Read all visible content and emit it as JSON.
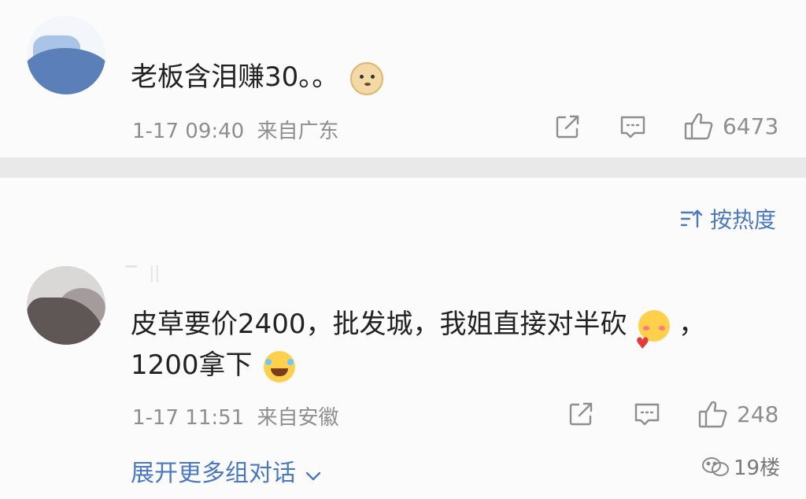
{
  "comments": [
    {
      "text": "老板含泪赚30。。",
      "emoji_end": "doge-emoji",
      "time": "1-17 09:40",
      "location": "来自广东",
      "likes": "6473"
    },
    {
      "line1": "皮草要价2400，批发城，我姐直接对半砍",
      "line1_tail": "，",
      "line2": "1200拿下",
      "emoji_mid": "shy-emoji",
      "emoji_end": "laugh-cry-emoji",
      "time": "1-17 11:51",
      "location": "来自安徽",
      "likes": "248"
    }
  ],
  "sort": {
    "label": "按热度"
  },
  "expand": {
    "label": "展开更多组对话"
  },
  "watermark": {
    "label": "19楼"
  },
  "colors": {
    "link": "#4a78c2",
    "meta": "#8e8e8e",
    "text": "#222222",
    "divider": "#e9e9e9"
  }
}
